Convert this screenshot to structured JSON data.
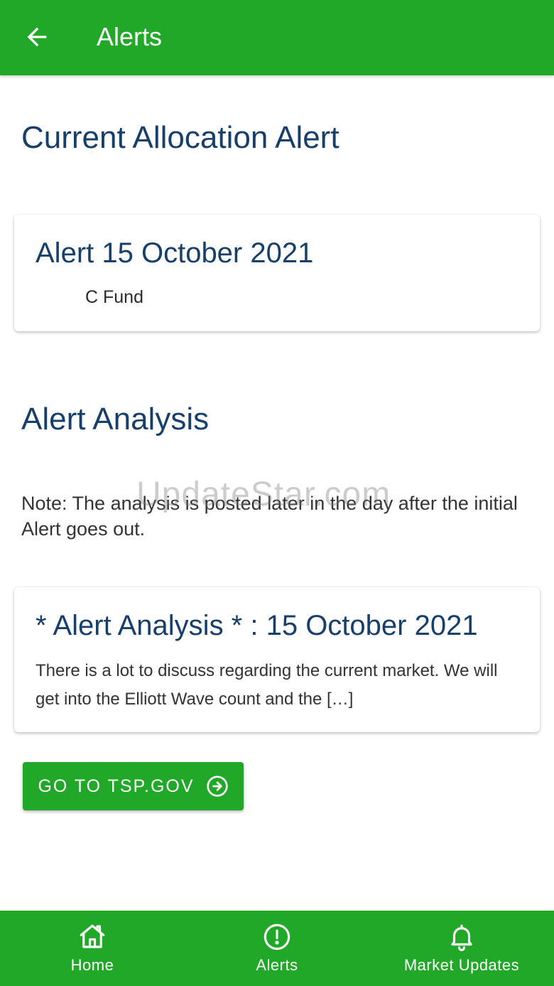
{
  "app_bar": {
    "title": "Alerts",
    "back_icon": "arrow-left-icon"
  },
  "current_allocation": {
    "heading": "Current Allocation Alert",
    "card": {
      "title": "Alert 15 October 2021",
      "fund": "C Fund"
    }
  },
  "analysis": {
    "heading": "Alert Analysis",
    "note": "Note: The analysis is posted later in the day after the initial Alert goes out.",
    "card": {
      "title": "* Alert Analysis * : 15 October 2021",
      "excerpt": "There is a lot to discuss regarding the current market. We will get into the Elliott Wave count and the […]"
    }
  },
  "watermark": "UpdateStar.com",
  "tsp_button": {
    "label": "GO TO TSP.GOV",
    "icon": "arrow-right-circle-icon"
  },
  "bottom_nav": {
    "items": [
      {
        "label": "Home",
        "icon": "home-icon"
      },
      {
        "label": "Alerts",
        "icon": "alert-circle-icon"
      },
      {
        "label": "Market Updates",
        "icon": "bell-icon"
      }
    ]
  },
  "colors": {
    "primary_green": "#22a828",
    "heading_navy": "#173f6a",
    "body_text": "#333333",
    "background": "#ffffff"
  }
}
